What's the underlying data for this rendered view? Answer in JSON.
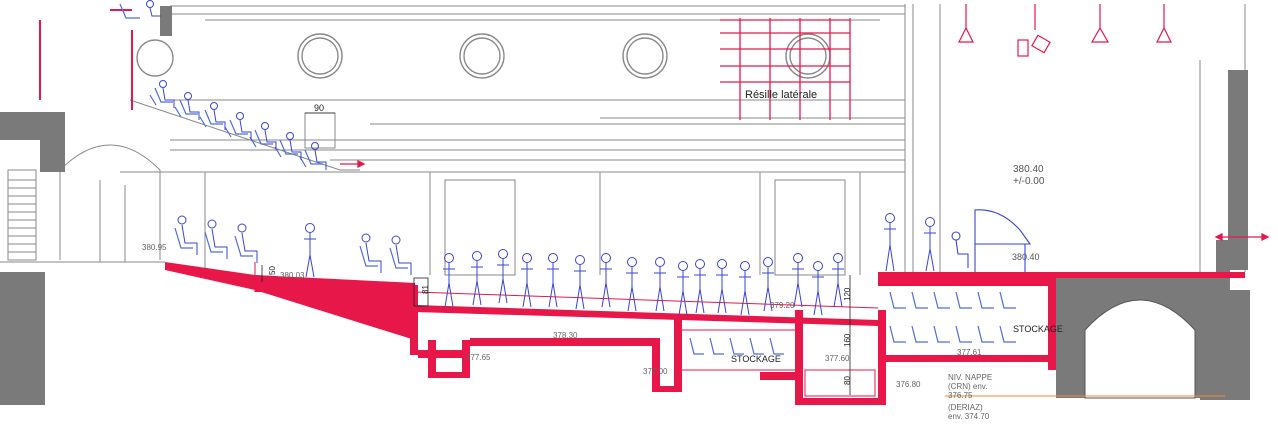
{
  "labels": {
    "resille": "Résille latérale",
    "stage_level": "380.40",
    "stage_level_ref": "+/-0.00",
    "stage_right_level": "380.40",
    "stockage_left": "STOCKAGE",
    "stockage_right": "STOCKAGE",
    "niv_nappe": "NIV. NAPPE",
    "crn": "(CRN) env.",
    "crn_value": "376.75",
    "deriaz": "(DERIAZ)",
    "deriaz_value": "env. 374.70"
  },
  "dimensions": {
    "d90": "90",
    "d50": "50",
    "d81": "81",
    "d120": "120",
    "d160": "160",
    "d80": "80"
  },
  "elevations": {
    "e38095": "380.95",
    "e38003": "380.03",
    "e37920": "379.20",
    "e37830": "378.30",
    "e37765": "377.65",
    "e37700": "377.00",
    "e37760": "377.60",
    "e37761": "377.61",
    "e37680": "376.80"
  },
  "colors": {
    "line": "#8a8a8a",
    "wall": "#7a7a7a",
    "red": "#e8174a",
    "figure": "#3a45d6",
    "seat": "#4f6ddc",
    "text": "#222222"
  }
}
